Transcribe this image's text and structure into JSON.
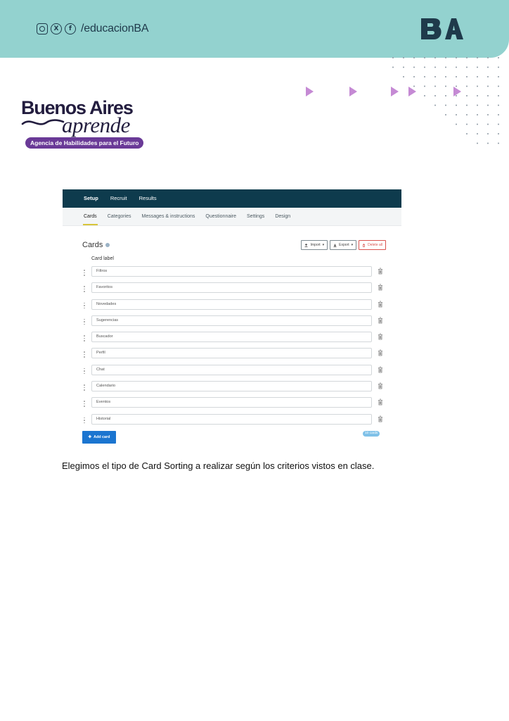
{
  "header": {
    "social_handle": "/educacionBA",
    "icons": [
      "instagram-icon",
      "x-icon",
      "facebook-icon"
    ],
    "ba_logo_text": "BA",
    "band_color": "#93d2cf"
  },
  "brand": {
    "title": "Buenos Aires",
    "script": "aprende",
    "badge": "Agencia de Habilidades para el Futuro",
    "accent_color": "#6a3a97"
  },
  "app": {
    "top_tabs": [
      "Setup",
      "Recruit",
      "Results"
    ],
    "sub_tabs": [
      "Cards",
      "Categories",
      "Messages & instructions",
      "Questionnaire",
      "Settings",
      "Design"
    ],
    "section_title": "Cards",
    "buttons": {
      "import": "Import",
      "export": "Export",
      "delete_all": "Delete all"
    },
    "column_label": "Card label",
    "cards": [
      "Filtros",
      "Favoritos",
      "Novedades",
      "Sugerencias",
      "Buscador",
      "Perfil",
      "Chat",
      "Calendario",
      "Eventos",
      "Historial"
    ],
    "add_card": "Add card",
    "count": "10 cards",
    "nav_color": "#0e3b4d",
    "primary_color": "#1b75d0"
  },
  "caption": "Elegimos el tipo de Card Sorting a realizar según los criterios vistos en clase."
}
